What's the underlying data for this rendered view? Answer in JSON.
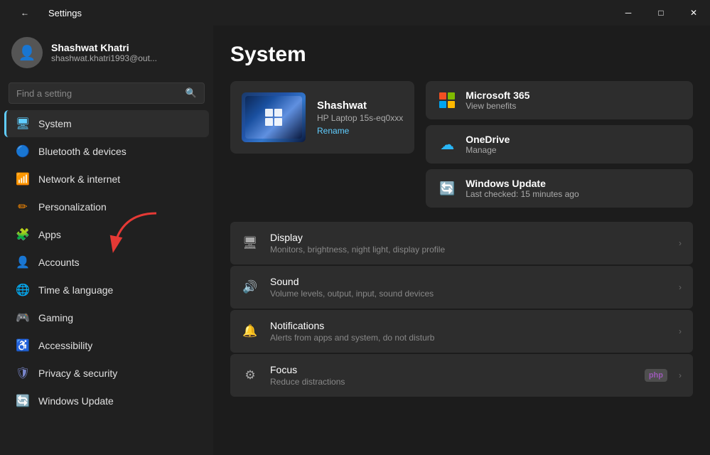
{
  "titlebar": {
    "back_icon": "←",
    "title": "Settings",
    "minimize_label": "─",
    "maximize_label": "□",
    "close_label": "✕"
  },
  "sidebar": {
    "user": {
      "name": "Shashwat Khatri",
      "email": "shashwat.khatri1993@out...",
      "avatar_icon": "👤"
    },
    "search": {
      "placeholder": "Find a setting",
      "icon": "🔍"
    },
    "nav_items": [
      {
        "id": "system",
        "label": "System",
        "icon": "🖥",
        "icon_class": "blue",
        "active": true
      },
      {
        "id": "bluetooth",
        "label": "Bluetooth & devices",
        "icon": "🔵",
        "icon_class": "blue"
      },
      {
        "id": "network",
        "label": "Network & internet",
        "icon": "📶",
        "icon_class": "teal"
      },
      {
        "id": "personalization",
        "label": "Personalization",
        "icon": "✏",
        "icon_class": "orange"
      },
      {
        "id": "apps",
        "label": "Apps",
        "icon": "🧩",
        "icon_class": "purple"
      },
      {
        "id": "accounts",
        "label": "Accounts",
        "icon": "👤",
        "icon_class": "cyan"
      },
      {
        "id": "time",
        "label": "Time & language",
        "icon": "🌐",
        "icon_class": "teal"
      },
      {
        "id": "gaming",
        "label": "Gaming",
        "icon": "🎮",
        "icon_class": "purple"
      },
      {
        "id": "accessibility",
        "label": "Accessibility",
        "icon": "♿",
        "icon_class": "light-blue"
      },
      {
        "id": "privacy",
        "label": "Privacy & security",
        "icon": "🛡",
        "icon_class": "indigo"
      },
      {
        "id": "update",
        "label": "Windows Update",
        "icon": "🔄",
        "icon_class": "cyan"
      }
    ]
  },
  "main": {
    "page_title": "System",
    "device": {
      "name": "Shashwat",
      "model": "HP Laptop 15s-eq0xxx",
      "rename": "Rename"
    },
    "services": [
      {
        "id": "ms365",
        "name": "Microsoft 365",
        "action": "View benefits",
        "icon_type": "ms365"
      },
      {
        "id": "onedrive",
        "name": "OneDrive",
        "action": "Manage",
        "icon_type": "onedrive"
      },
      {
        "id": "winupdate",
        "name": "Windows Update",
        "action": "Last checked: 15 minutes ago",
        "icon_type": "winupdate"
      }
    ],
    "settings": [
      {
        "id": "display",
        "icon": "🖥",
        "title": "Display",
        "subtitle": "Monitors, brightness, night light, display profile",
        "badge": null
      },
      {
        "id": "sound",
        "icon": "🔊",
        "title": "Sound",
        "subtitle": "Volume levels, output, input, sound devices",
        "badge": null
      },
      {
        "id": "notifications",
        "icon": "🔔",
        "title": "Notifications",
        "subtitle": "Alerts from apps and system, do not disturb",
        "badge": null
      },
      {
        "id": "focus",
        "icon": "⚙",
        "title": "Focus",
        "subtitle": "Reduce distractions",
        "badge": "php"
      }
    ]
  }
}
